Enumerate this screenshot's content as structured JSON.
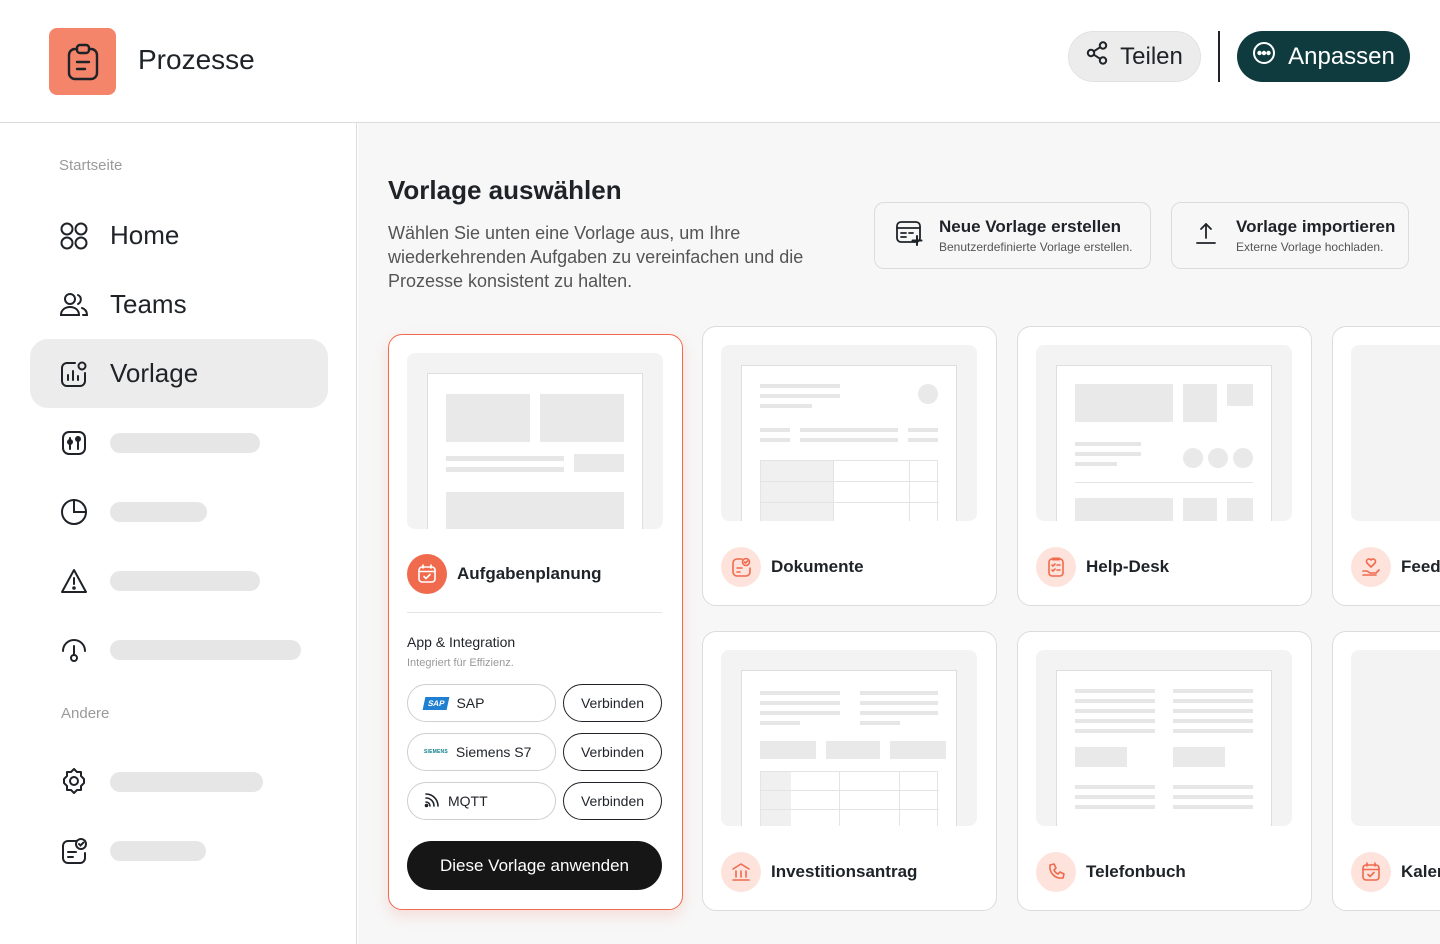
{
  "header": {
    "app_title": "Prozesse",
    "share_label": "Teilen",
    "customize_label": "Anpassen"
  },
  "sidebar": {
    "section_start": "Startseite",
    "section_other": "Andere",
    "items": [
      {
        "label": "Home",
        "icon": "grid-icon"
      },
      {
        "label": "Teams",
        "icon": "users-icon"
      },
      {
        "label": "Vorlage",
        "icon": "chart-icon",
        "active": true
      }
    ]
  },
  "main": {
    "title": "Vorlage auswählen",
    "description": "Wählen Sie unten eine Vorlage aus, um Ihre wiederkehrenden Aufgaben zu vereinfachen und die Prozesse konsistent zu halten.",
    "new_template": {
      "title": "Neue Vorlage erstellen",
      "subtitle": "Benutzerdefinierte Vorlage erstellen."
    },
    "import_template": {
      "title": "Vorlage importieren",
      "subtitle": "Externe Vorlage hochladen."
    },
    "templates": [
      {
        "name": "Aufgabenplanung",
        "icon": "calendar-check-icon",
        "selected": true
      },
      {
        "name": "Dokumente",
        "icon": "document-check-icon"
      },
      {
        "name": "Help-Desk",
        "icon": "checklist-icon"
      },
      {
        "name": "Feedl",
        "icon": "heart-hand-icon"
      },
      {
        "name": "Investitionsantrag",
        "icon": "bank-icon"
      },
      {
        "name": "Telefonbuch",
        "icon": "phone-icon"
      },
      {
        "name": "Kaler",
        "icon": "calendar-icon"
      }
    ],
    "integration": {
      "title": "App & Integration",
      "subtitle": "Integriert für Effizienz.",
      "items": [
        {
          "name": "SAP",
          "logo": "SAP",
          "action": "Verbinden"
        },
        {
          "name": "Siemens S7",
          "logo": "SIEMENS",
          "action": "Verbinden"
        },
        {
          "name": "MQTT",
          "logo": "rss-icon",
          "action": "Verbinden"
        }
      ]
    },
    "apply_label": "Diese Vorlage anwenden"
  },
  "colors": {
    "accent": "#f06a4e",
    "logo_bg": "#f4846a",
    "primary_dark": "#0f3b3f",
    "icon_bg": "#fde3dc"
  }
}
